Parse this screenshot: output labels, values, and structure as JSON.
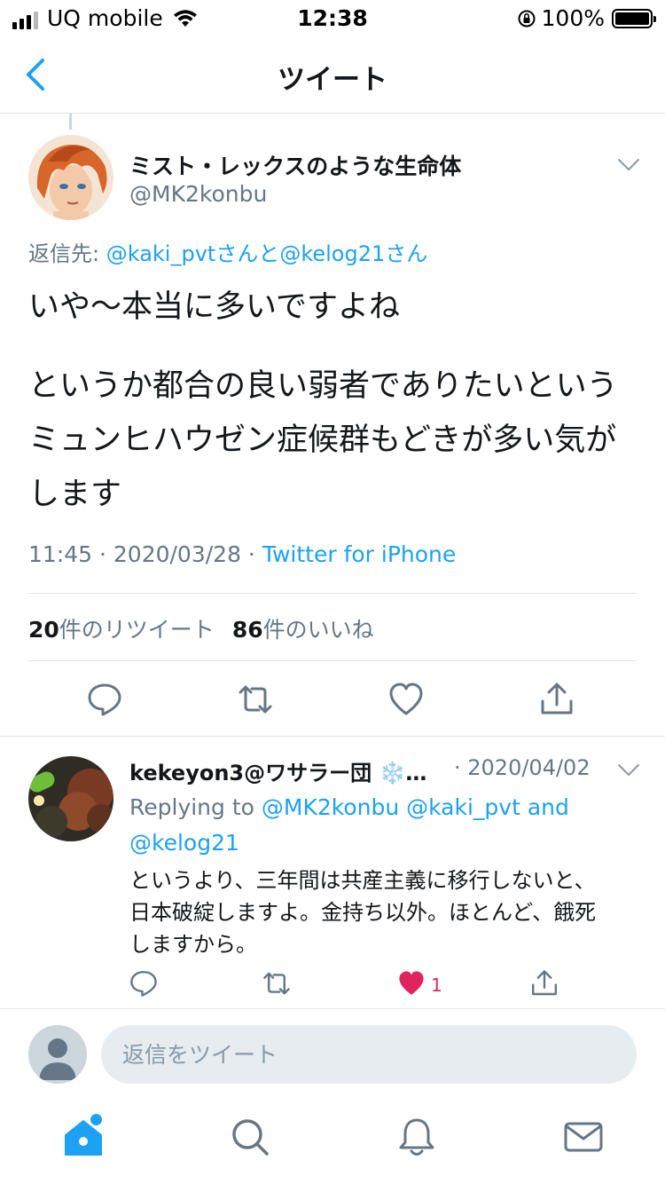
{
  "status_bar": {
    "carrier": "UQ mobile",
    "time": "12:38",
    "battery": "100%"
  },
  "nav": {
    "title": "ツイート"
  },
  "main_tweet": {
    "display_name": "ミスト・レックスのような生命体",
    "handle": "@MK2konbu",
    "replying_prefix": "返信先: ",
    "replying_to": "@kaki_pvtさんと@kelog21さん",
    "text_line1": "いや〜本当に多いですよね",
    "text_line2": "というか都合の良い弱者でありたいというミュンヒハウゼン症候群もどきが多い気がします",
    "time": "11:45",
    "date": "2020/03/28",
    "source": "Twitter for iPhone",
    "retweet_count": "20",
    "retweet_label": "件のリツイート",
    "like_count": "86",
    "like_label": "件のいいね"
  },
  "reply_tweet": {
    "display_name": "kekeyon3@ワサラー団 ❄️…",
    "date": "· 2020/04/02",
    "replying_prefix": "Replying to ",
    "replying_handles": "@MK2konbu @kaki_pvt and @kelog21",
    "text": "というより、三年間は共産主義に移行しないと、日本破綻しますよ。金持ち以外。ほとんど、餓死しますから。",
    "like_count": "1"
  },
  "compose": {
    "placeholder": "返信をツイート"
  },
  "colors": {
    "accent": "#1da1f2",
    "like": "#e0245e",
    "secondary_text": "#657786"
  }
}
